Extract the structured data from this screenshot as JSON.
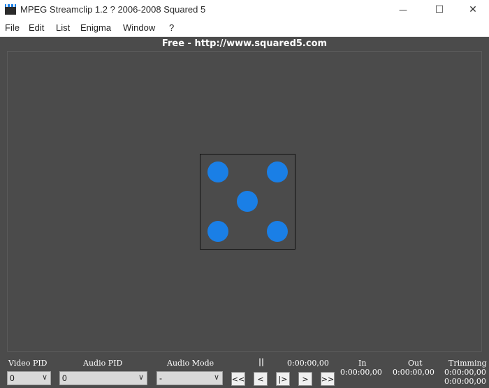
{
  "window": {
    "title": "MPEG Streamclip 1.2  ? 2006-2008 Squared 5",
    "minimize_glyph": "—",
    "maximize_glyph": "☐",
    "close_glyph": "✕"
  },
  "menu": [
    "File",
    "Edit",
    "List",
    "Enigma",
    "Window",
    "?"
  ],
  "banner": "Free  -  http://www.squared5.com",
  "viewer": {
    "pip_color": "#1a7fe6",
    "background": "#4b4b4b"
  },
  "controls": {
    "video_pid_label": "Video PID",
    "video_pid_value": "0",
    "audio_pid_label": "Audio PID",
    "audio_pid_value": "0",
    "audio_mode_label": "Audio Mode",
    "audio_mode_value": "-",
    "pause_glyph": "||",
    "current_time": "0:00:00,00",
    "in_label": "In",
    "in_time": "0:00:00,00",
    "out_label": "Out",
    "out_time": "0:00:00,00",
    "trimming_label": "Trimming",
    "trimming_time_1": "0:00:00,00",
    "trimming_time_2": "0:00:00,00",
    "transport": [
      "<<",
      "<",
      "|>",
      ">",
      ">>"
    ]
  }
}
